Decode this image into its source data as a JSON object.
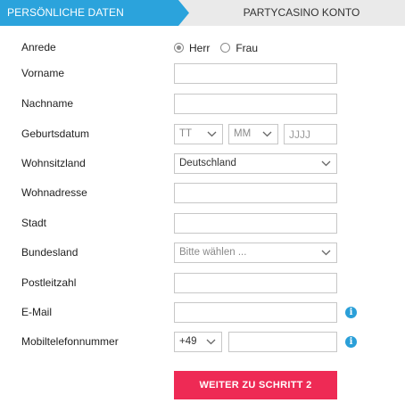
{
  "steps": {
    "active": "PERSÖNLICHE DATEN",
    "next": "PARTYCASINO KONTO"
  },
  "form": {
    "salutation": {
      "label": "Anrede",
      "options": [
        "Herr",
        "Frau"
      ],
      "selected": "Herr"
    },
    "firstname": {
      "label": "Vorname",
      "value": ""
    },
    "lastname": {
      "label": "Nachname",
      "value": ""
    },
    "birthdate": {
      "label": "Geburtsdatum",
      "day": "TT",
      "month": "MM",
      "year_placeholder": "JJJJ"
    },
    "country": {
      "label": "Wohnsitzland",
      "value": "Deutschland"
    },
    "address": {
      "label": "Wohnadresse",
      "value": ""
    },
    "city": {
      "label": "Stadt",
      "value": ""
    },
    "state": {
      "label": "Bundesland",
      "placeholder": "Bitte wählen ..."
    },
    "zip": {
      "label": "Postleitzahl",
      "value": ""
    },
    "email": {
      "label": "E-Mail",
      "value": "",
      "info_icon": "info-icon"
    },
    "mobile": {
      "label": "Mobiltelefonnummer",
      "prefix": "+49",
      "value": "",
      "info_icon": "info-icon"
    },
    "submit_label": "WEITER ZU SCHRITT 2"
  },
  "colors": {
    "accent": "#2ba3dc",
    "submit": "#ee2a55",
    "tab_inactive": "#eaeaea"
  }
}
